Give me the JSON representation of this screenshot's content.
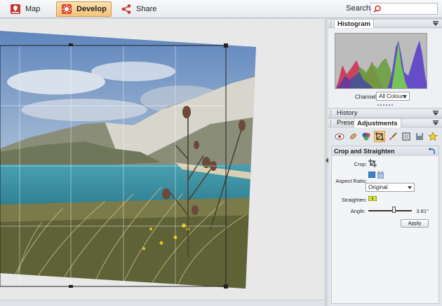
{
  "toolbar": {
    "map_label": "Map",
    "develop_label": "Develop",
    "share_label": "Share",
    "search_label": "Search"
  },
  "histogram": {
    "title": "Histogram",
    "channel_label": "Channel:",
    "channel_value": "All Colours"
  },
  "history": {
    "title": "History"
  },
  "tabs": {
    "presets": "Presets",
    "adjustments": "Adjustments"
  },
  "crop": {
    "title": "Crop and Straighten",
    "crop_label": "Crop:",
    "aspect_label": "Aspect Ratio:",
    "aspect_value": "Original",
    "straighten_label": "Straighten:",
    "angle_label": "Angle:",
    "angle_value": "3.81°",
    "angle_fraction": 0.6,
    "apply_label": "Apply"
  },
  "colors": {
    "accent": "#f4c37a",
    "toolbar_bg": "#e7eaee",
    "panel_bg": "#e4e7ec"
  }
}
